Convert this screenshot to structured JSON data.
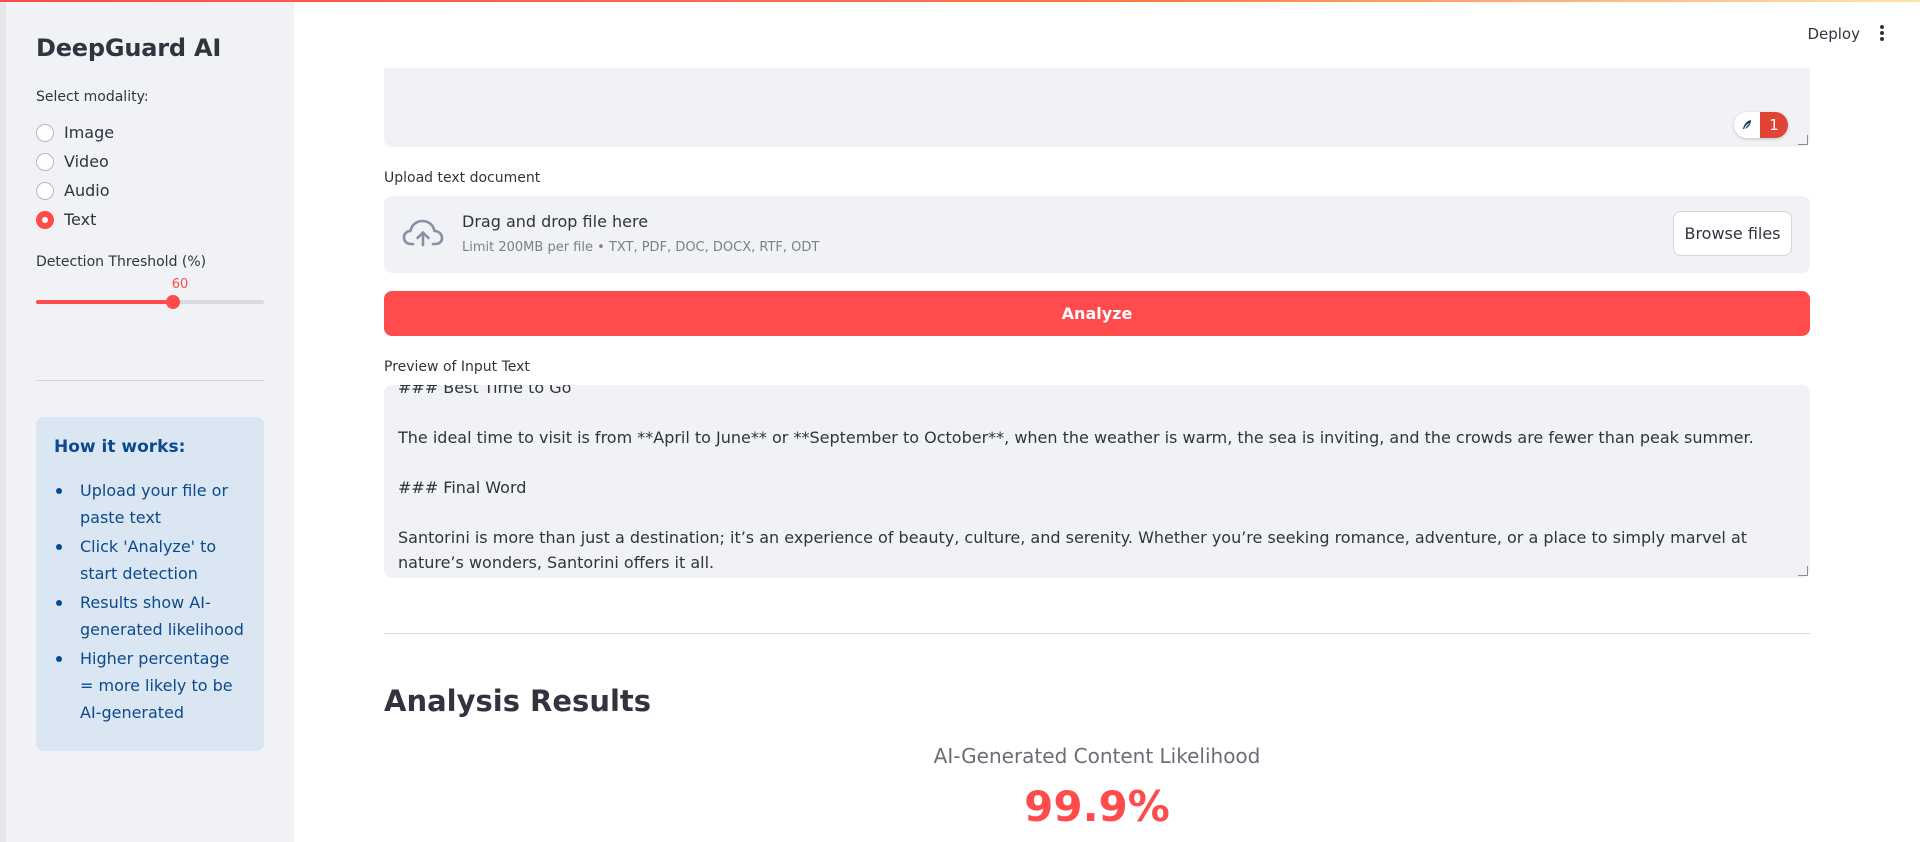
{
  "app": {
    "title": "DeepGuard AI"
  },
  "sidebar": {
    "modality_label": "Select modality:",
    "modalities": [
      {
        "label": "Image",
        "selected": false
      },
      {
        "label": "Video",
        "selected": false
      },
      {
        "label": "Audio",
        "selected": false
      },
      {
        "label": "Text",
        "selected": true
      }
    ],
    "threshold": {
      "label": "Detection Threshold (%)",
      "value": "60",
      "fraction": 0.6
    },
    "info": {
      "heading": "How it works:",
      "items": [
        "Upload your file or paste text",
        "Click 'Analyze' to start detection",
        "Results show AI-generated likelihood",
        "Higher percentage = more likely to be AI-generated"
      ]
    }
  },
  "header": {
    "deploy_label": "Deploy",
    "menu_icon": "more-vertical-icon"
  },
  "editor": {
    "badge_icon": "feather-icon",
    "badge_count": "1"
  },
  "upload": {
    "label": "Upload text document",
    "drop_title": "Drag and drop file here",
    "limits": "Limit 200MB per file • TXT, PDF, DOC, DOCX, RTF, ODT",
    "browse_label": "Browse files",
    "icon": "cloud-upload-icon"
  },
  "analyze": {
    "label": "Analyze"
  },
  "preview": {
    "label": "Preview of Input Text",
    "lines": [
      "### Best Time to Go",
      "The ideal time to visit is from **April to June** or **September to October**, when the weather is warm, the sea is inviting, and the crowds are fewer than peak summer.",
      "### Final Word",
      "Santorini is more than just a destination; it’s an experience of beauty, culture, and serenity. Whether you’re seeking romance, adventure, or a place to simply marvel at nature’s wonders, Santorini offers it all."
    ]
  },
  "results": {
    "heading": "Analysis Results",
    "likelihood_label": "AI-Generated Content Likelihood",
    "likelihood_value": "99.9%",
    "accent_color": "#ff4b4b"
  }
}
